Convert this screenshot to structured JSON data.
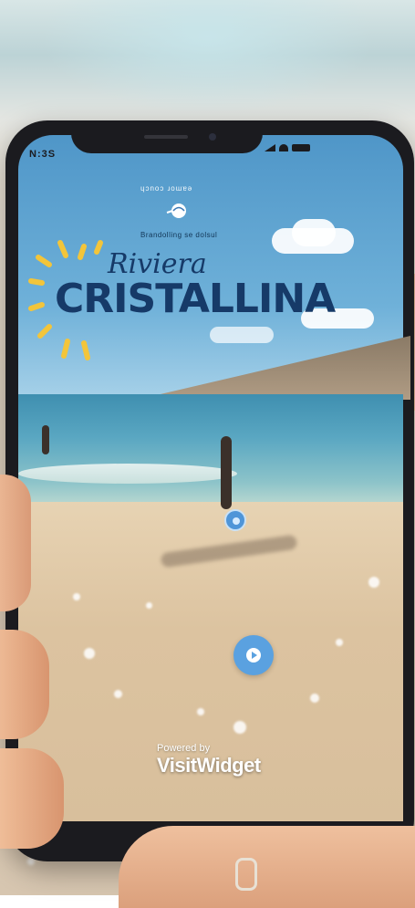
{
  "app": {
    "status_time": "N:3S",
    "top_label": "ɥɔnoɔ ɹoɯɐǝ",
    "subtitle": "Brandolling se dolsul",
    "title_script": "Riviera",
    "title_main": "CRISTALLINA",
    "powered_by": "Powered by",
    "brand": "VisitWidget"
  },
  "colors": {
    "title": "#163a68",
    "sun": "#f3c53a",
    "button": "#5aa1e0"
  },
  "icons": [
    "shell-logo-icon",
    "location-dot-icon",
    "play-icon",
    "sun-icon",
    "battery-icon",
    "wifi-icon",
    "signal-icon"
  ]
}
